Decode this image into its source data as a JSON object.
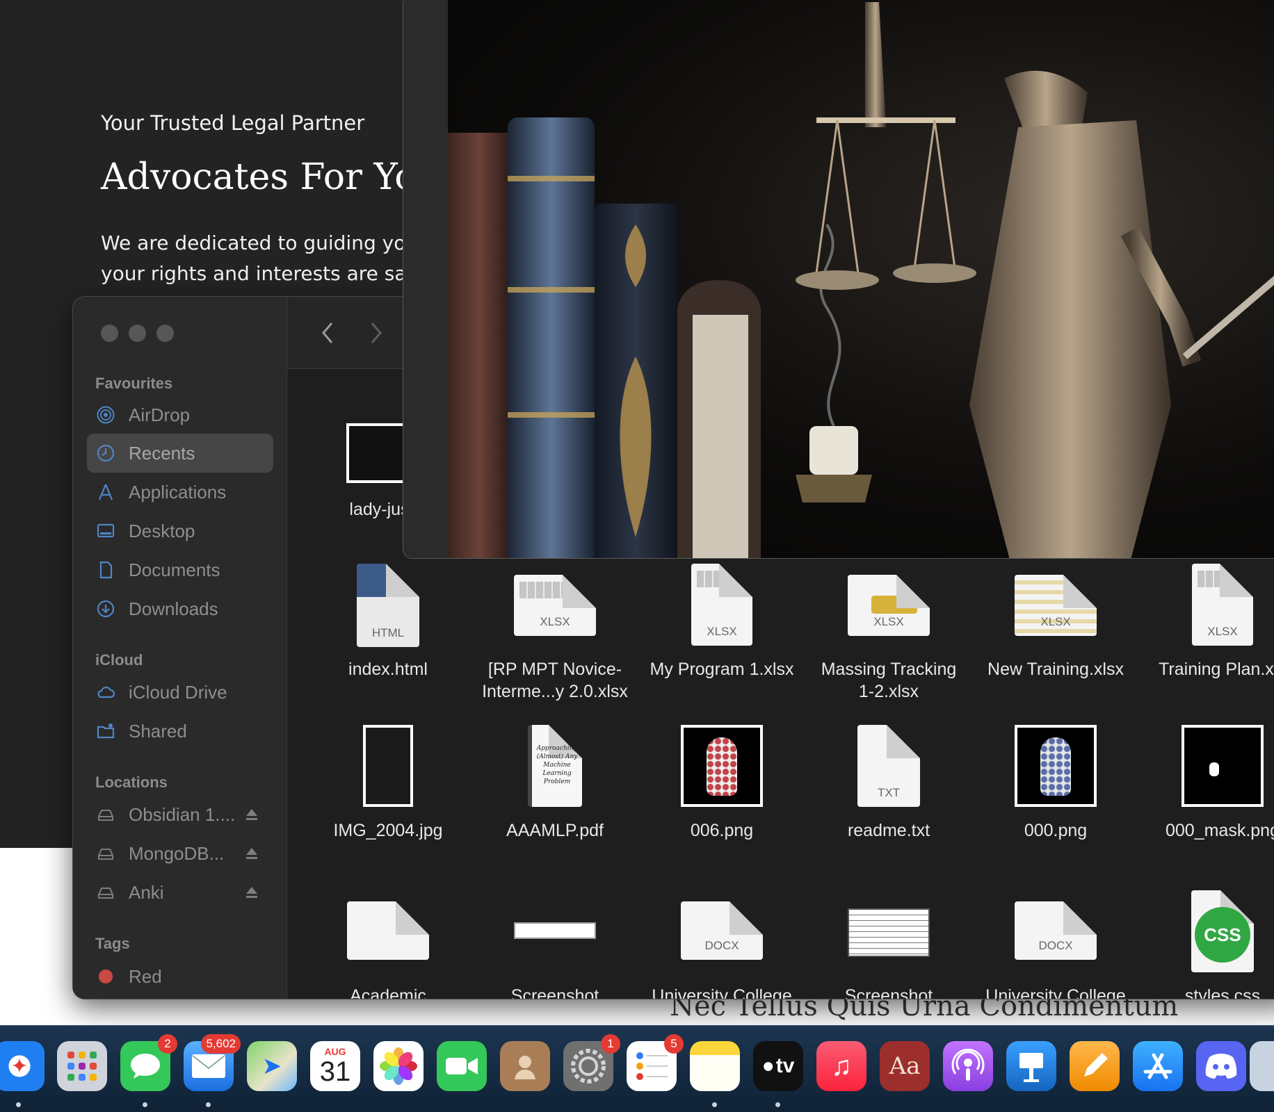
{
  "website": {
    "eyebrow": "Your Trusted Legal Partner",
    "heading": "Advocates For Your",
    "text_line1": "We are dedicated to guiding yo",
    "text_line2": "your rights and interests are sa",
    "footer_heading": "Nec Tellus Quis Urna Condimentum"
  },
  "finder": {
    "sidebar": {
      "favourites_label": "Favourites",
      "favourites": [
        {
          "label": "AirDrop",
          "icon": "airdrop-icon"
        },
        {
          "label": "Recents",
          "icon": "clock-icon",
          "selected": true
        },
        {
          "label": "Applications",
          "icon": "applications-icon"
        },
        {
          "label": "Desktop",
          "icon": "desktop-icon"
        },
        {
          "label": "Documents",
          "icon": "document-icon"
        },
        {
          "label": "Downloads",
          "icon": "download-icon"
        }
      ],
      "icloud_label": "iCloud",
      "icloud": [
        {
          "label": "iCloud Drive",
          "icon": "cloud-icon"
        },
        {
          "label": "Shared",
          "icon": "shared-folder-icon"
        }
      ],
      "locations_label": "Locations",
      "locations": [
        {
          "label": "Obsidian 1....",
          "icon": "drive-icon"
        },
        {
          "label": "MongoDB...",
          "icon": "drive-icon"
        },
        {
          "label": "Anki",
          "icon": "drive-icon"
        }
      ],
      "tags_label": "Tags",
      "tags": [
        {
          "label": "Red",
          "color": "#e0443b"
        }
      ]
    },
    "files_row1": [
      {
        "name": "lady-justic",
        "kind": "image"
      }
    ],
    "files_row2": [
      {
        "name": "index.html",
        "ext": "HTML"
      },
      {
        "name": "[RP MPT Novice-",
        "name2": "Interme...y 2.0.xlsx",
        "ext": "XLSX"
      },
      {
        "name": "My Program 1.xlsx",
        "ext": "XLSX"
      },
      {
        "name": "Massing Tracking",
        "name2": "1-2.xlsx",
        "ext": "XLSX"
      },
      {
        "name": "New Training.xlsx",
        "ext": "XLSX"
      },
      {
        "name": "Training Plan.xls",
        "ext": "XLSX"
      }
    ],
    "files_row3": [
      {
        "name": "IMG_2004.jpg"
      },
      {
        "name": "AAAMLP.pdf",
        "cover_text": "Approaching (Almost) Any Machine Learning Problem"
      },
      {
        "name": "006.png"
      },
      {
        "name": "readme.txt",
        "ext": "TXT"
      },
      {
        "name": "000.png"
      },
      {
        "name": "000_mask.png"
      }
    ],
    "files_row4": [
      {
        "name": "Academic"
      },
      {
        "name": "Screenshot"
      },
      {
        "name": "University College",
        "ext": "DOCX"
      },
      {
        "name": "Screenshot"
      },
      {
        "name": "University College",
        "ext": "DOCX"
      },
      {
        "name": "styles.css",
        "ext": "CSS"
      }
    ]
  },
  "dock": {
    "apps": [
      {
        "name": "Safari",
        "icon": "safari-icon",
        "color": "#1f7ff0"
      },
      {
        "name": "Launchpad",
        "icon": "launchpad-icon",
        "color": "#d9dde4"
      },
      {
        "name": "Messages",
        "icon": "messages-icon",
        "color": "#34c759",
        "badge": "2"
      },
      {
        "name": "Mail",
        "icon": "mail-icon",
        "color": "#3b93ef",
        "badge": "5,602"
      },
      {
        "name": "Maps",
        "icon": "maps-icon",
        "color": "#6fcf6a"
      },
      {
        "name": "Calendar",
        "icon": "calendar-icon",
        "color": "#ffffff",
        "month": "AUG",
        "day": "31"
      },
      {
        "name": "Photos",
        "icon": "photos-icon",
        "color": "#ffffff"
      },
      {
        "name": "FaceTime",
        "icon": "facetime-icon",
        "color": "#34c759"
      },
      {
        "name": "Contacts",
        "icon": "contacts-icon",
        "color": "#a07a52"
      },
      {
        "name": "System Settings",
        "icon": "settings-icon",
        "color": "#8e8e93",
        "badge": "1"
      },
      {
        "name": "Reminders",
        "icon": "reminders-icon",
        "color": "#ffffff",
        "badge": "5"
      },
      {
        "name": "Notes",
        "icon": "notes-icon",
        "color": "#fbd63b"
      },
      {
        "name": "TV",
        "icon": "tv-icon",
        "color": "#111111",
        "label": "tv"
      },
      {
        "name": "Music",
        "icon": "music-icon",
        "color": "#fa3b4c"
      },
      {
        "name": "Dictionary",
        "icon": "dictionary-icon",
        "color": "#9c2f2c",
        "label": "Aa"
      },
      {
        "name": "Podcasts",
        "icon": "podcasts-icon",
        "color": "#9b4ee0"
      },
      {
        "name": "Keynote",
        "icon": "keynote-icon",
        "color": "#1e88e5"
      },
      {
        "name": "Pages",
        "icon": "pages-icon",
        "color": "#f69a1e"
      },
      {
        "name": "App Store",
        "icon": "app-store-icon",
        "color": "#1e90ff"
      },
      {
        "name": "Discord",
        "icon": "discord-icon",
        "color": "#5865f2"
      },
      {
        "name": "Preview",
        "icon": "preview-icon",
        "color": "#c7d3df"
      }
    ]
  }
}
